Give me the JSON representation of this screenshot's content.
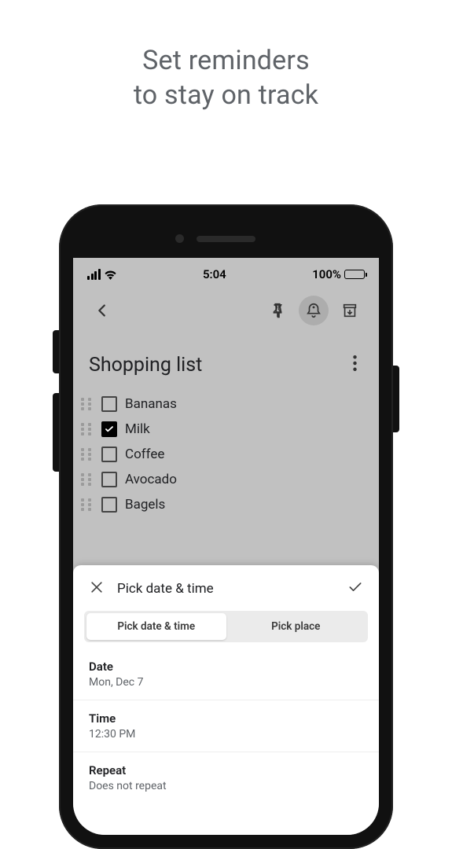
{
  "promo": {
    "line1": "Set reminders",
    "line2": "to stay on track"
  },
  "status_bar": {
    "time": "5:04",
    "battery_text": "100%"
  },
  "note": {
    "title": "Shopping list",
    "items": [
      {
        "text": "Bananas",
        "checked": false
      },
      {
        "text": "Milk",
        "checked": true
      },
      {
        "text": "Coffee",
        "checked": false
      },
      {
        "text": "Avocado",
        "checked": false
      },
      {
        "text": "Bagels",
        "checked": false
      }
    ]
  },
  "reminder_sheet": {
    "title": "Pick date & time",
    "tabs": {
      "date_time": "Pick date & time",
      "place": "Pick place"
    },
    "fields": {
      "date": {
        "label": "Date",
        "value": "Mon, Dec 7"
      },
      "time": {
        "label": "Time",
        "value": "12:30 PM"
      },
      "repeat": {
        "label": "Repeat",
        "value": "Does not repeat"
      }
    }
  }
}
